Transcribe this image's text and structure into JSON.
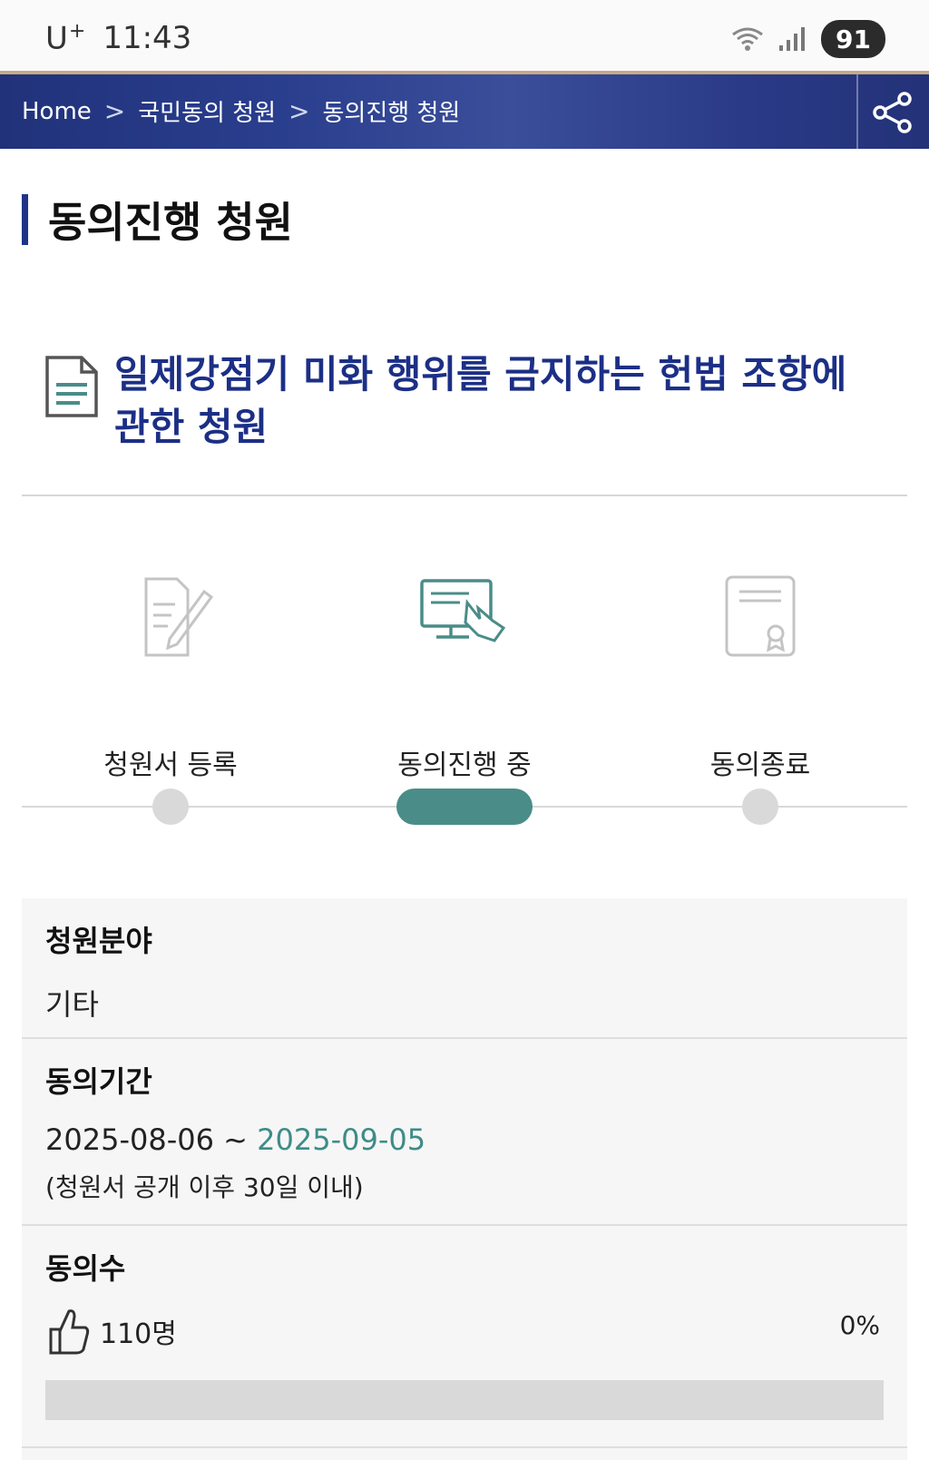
{
  "status_bar": {
    "carrier": "U",
    "carrier_sup": "+",
    "time": "11:43",
    "battery": "91"
  },
  "breadcrumb": {
    "home": "Home",
    "level1": "국민동의 청원",
    "level2": "동의진행 청원",
    "separator": ">"
  },
  "page": {
    "title": "동의진행 청원"
  },
  "petition": {
    "title": "일제강점기 미화 행위를 금지하는 헌법 조항에 관한 청원"
  },
  "steps": [
    {
      "label": "청원서 등록",
      "icon": "document-pen-icon",
      "active": false
    },
    {
      "label": "동의진행 중",
      "icon": "monitor-touch-icon",
      "active": true
    },
    {
      "label": "동의종료",
      "icon": "certificate-icon",
      "active": false
    }
  ],
  "info": {
    "field": {
      "label": "청원분야",
      "value": "기타"
    },
    "period": {
      "label": "동의기간",
      "start": "2025-08-06",
      "tilde": "~",
      "end": "2025-09-05",
      "note": "(청원서 공개 이후 30일 이내)"
    },
    "agree": {
      "label": "동의수",
      "count": "110명",
      "percent_text": "0%",
      "progress": 0
    }
  },
  "colors": {
    "nav_bg": "#2a3e8e",
    "title_accent": "#1f3488",
    "petition_title": "#1c2f86",
    "teal": "#4a8c88"
  }
}
